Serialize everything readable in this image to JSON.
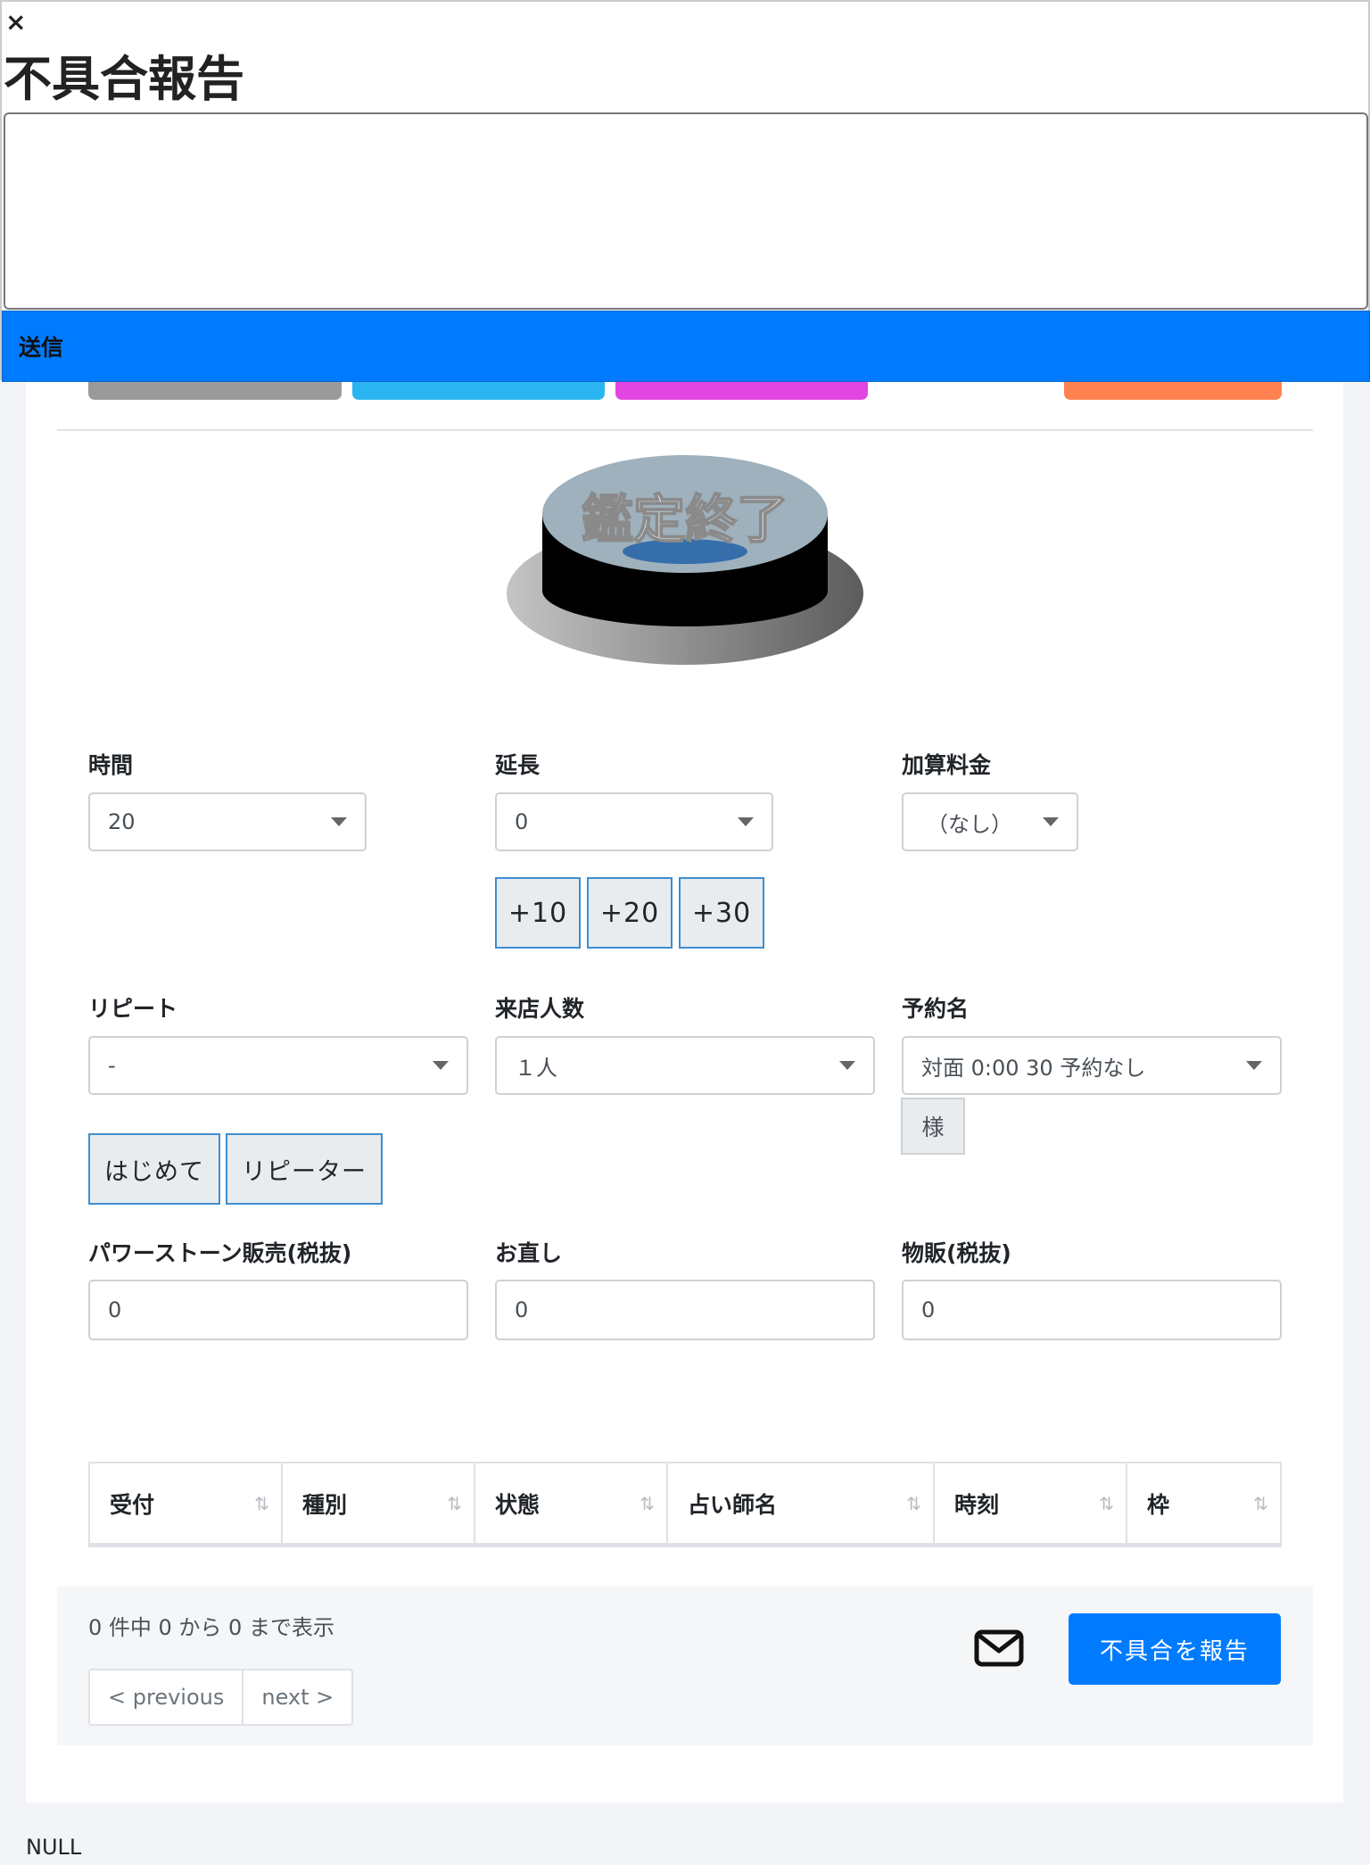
{
  "modal": {
    "close_label": "×",
    "title": "不具合報告",
    "textarea_value": "",
    "send_label": "送信"
  },
  "color_tabs": [
    {
      "color": "#9a9a9a"
    },
    {
      "color": "#2ab5f2"
    },
    {
      "color": "#e246e2"
    },
    {
      "color": "#ff8250"
    }
  ],
  "big_button": {
    "label": "鑑定終了"
  },
  "form": {
    "time": {
      "label": "時間",
      "value": "20"
    },
    "extension": {
      "label": "延長",
      "value": "0",
      "buttons": [
        "+10",
        "+20",
        "+30"
      ]
    },
    "surcharge": {
      "label": "加算料金",
      "value": "（なし）"
    },
    "repeat": {
      "label": "リピート",
      "value": "-",
      "buttons": [
        "はじめて",
        "リピーター"
      ]
    },
    "visitors": {
      "label": "来店人数",
      "value": "１人"
    },
    "reservation": {
      "label": "予約名",
      "value": "対面 0:00 30 予約なし",
      "suffix": "様"
    },
    "powerstone": {
      "label": "パワーストーン販売(税抜)",
      "value": "0"
    },
    "fix": {
      "label": "お直し",
      "value": "0"
    },
    "goods": {
      "label": "物販(税抜)",
      "value": "0"
    }
  },
  "table": {
    "columns": [
      "受付",
      "種別",
      "状態",
      "占い師名",
      "時刻",
      "枠"
    ],
    "sort_icon": "⇅"
  },
  "footer": {
    "info": "0 件中 0 から 0 まで表示",
    "prev_label": "< previous",
    "next_label": "next >",
    "report_label": "不具合を報告"
  },
  "null_text": "NULL"
}
